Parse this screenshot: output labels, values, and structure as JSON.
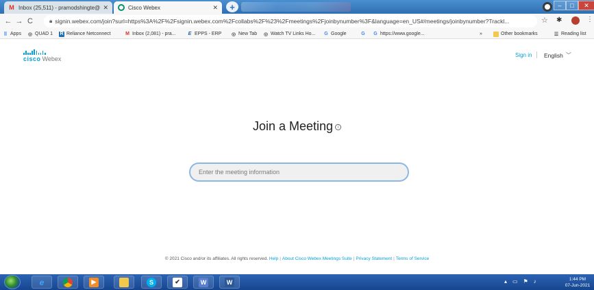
{
  "browser": {
    "tabs": [
      {
        "title": "Inbox (25,511) - pramodshingte@",
        "favicon": "gmail-icon",
        "active": false
      },
      {
        "title": "Cisco Webex",
        "favicon": "webex-icon",
        "active": true
      }
    ],
    "url": "signin.webex.com/join?surl=https%3A%2F%2Fsignin.webex.com%2Fcollabs%2F%23%2Fmeetings%2Fjoinbynumber%3F&language=en_US#/meetings/joinbynumber?Trackl...",
    "bookmarks": [
      {
        "label": "Apps",
        "icon": "apps-grid-icon"
      },
      {
        "label": "QUAD 1",
        "icon": "globe-icon"
      },
      {
        "label": "Reliance Netconnect",
        "icon": "reliance-icon"
      },
      {
        "label": "Inbox (2,081) - pra...",
        "icon": "gmail-icon"
      },
      {
        "label": "EPPS - ERP",
        "icon": "epps-icon"
      },
      {
        "label": "New Tab",
        "icon": "globe-icon"
      },
      {
        "label": "Watch TV Links Ho...",
        "icon": "globe-icon"
      },
      {
        "label": "Google",
        "icon": "google-icon"
      },
      {
        "label": "",
        "icon": "google-icon"
      },
      {
        "label": "https://www.google...",
        "icon": "google-icon"
      },
      {
        "label": "»",
        "icon": ""
      },
      {
        "label": "Other bookmarks",
        "icon": "folder-icon"
      },
      {
        "label": "Reading list",
        "icon": "reading-list-icon"
      }
    ]
  },
  "page": {
    "logo": {
      "cisco": "cisco",
      "webex": "Webex"
    },
    "signin": "Sign in",
    "language": "English",
    "heading": "Join a Meeting",
    "input_placeholder": "Enter the meeting information",
    "footer": {
      "copyright": "© 2021 Cisco and/or its affiliates. All rights reserved.",
      "links": [
        "Help",
        "About Cisco Webex Meetings Suite",
        "Privacy Statement",
        "Terms of Service"
      ]
    }
  },
  "taskbar": {
    "time": "1:44 PM",
    "date": "07-Jun-2021"
  },
  "colors": {
    "accent": "#049fd9",
    "taskbar": "#1f55a3",
    "input_border": "#8db7e3"
  }
}
